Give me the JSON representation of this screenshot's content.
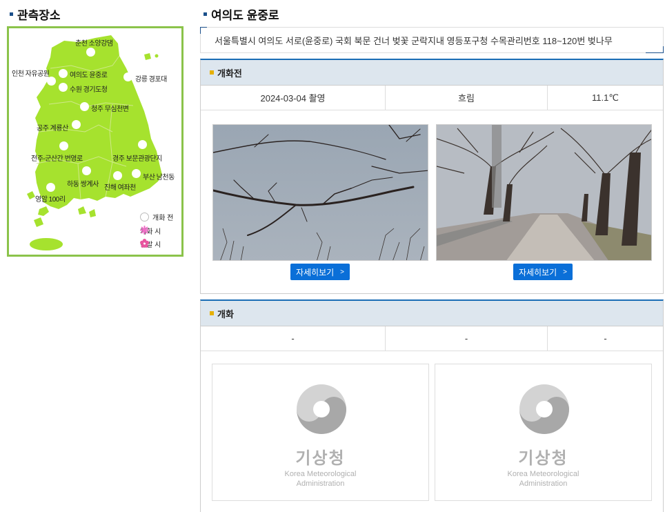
{
  "left": {
    "title": "관측장소",
    "map_locations": [
      {
        "name": "춘천 소양강댐"
      },
      {
        "name": "인천 자유공원"
      },
      {
        "name": "여의도 윤중로"
      },
      {
        "name": "강릉 경포대"
      },
      {
        "name": "수원 경기도청"
      },
      {
        "name": "청주 무심천변"
      },
      {
        "name": "공주 계룡산"
      },
      {
        "name": "전주-군산간 번영로"
      },
      {
        "name": "경주 보문관광단지"
      },
      {
        "name": "하동 쌍계사"
      },
      {
        "name": "부산 남천동"
      },
      {
        "name": "진해 여좌천"
      },
      {
        "name": "영암 100리"
      }
    ],
    "legend": [
      {
        "label": "개화 전",
        "icon": "white-circle-icon"
      },
      {
        "label": "개화 시",
        "icon": "blossom-pink-icon",
        "color": "#f06ec8"
      },
      {
        "label": "만발 시",
        "icon": "blossom-full-icon",
        "color": "#d9308f"
      }
    ]
  },
  "right": {
    "title": "여의도 윤중로",
    "address": "서울특별시 여의도 서로(윤중로) 국회 북문 건너 벚꽃 군락지내 영등포구청 수목관리번호 118~120번 벚나무",
    "before": {
      "heading": "개화전",
      "date": "2024-03-04 촬영",
      "weather": "흐림",
      "temperature": "11.1℃",
      "buttons": [
        "자세히보기",
        "자세히보기"
      ]
    },
    "bloom": {
      "heading": "개화",
      "date": "-",
      "weather": "-",
      "temperature": "-",
      "logo_korean": "기상청",
      "logo_english_1": "Korea Meteorological",
      "logo_english_2": "Administration"
    }
  },
  "colors": {
    "map_fill": "#a6e22e",
    "accent_blue": "#1a6db5",
    "button_blue": "#0a6fd8",
    "header_bg": "#dde6ee"
  }
}
